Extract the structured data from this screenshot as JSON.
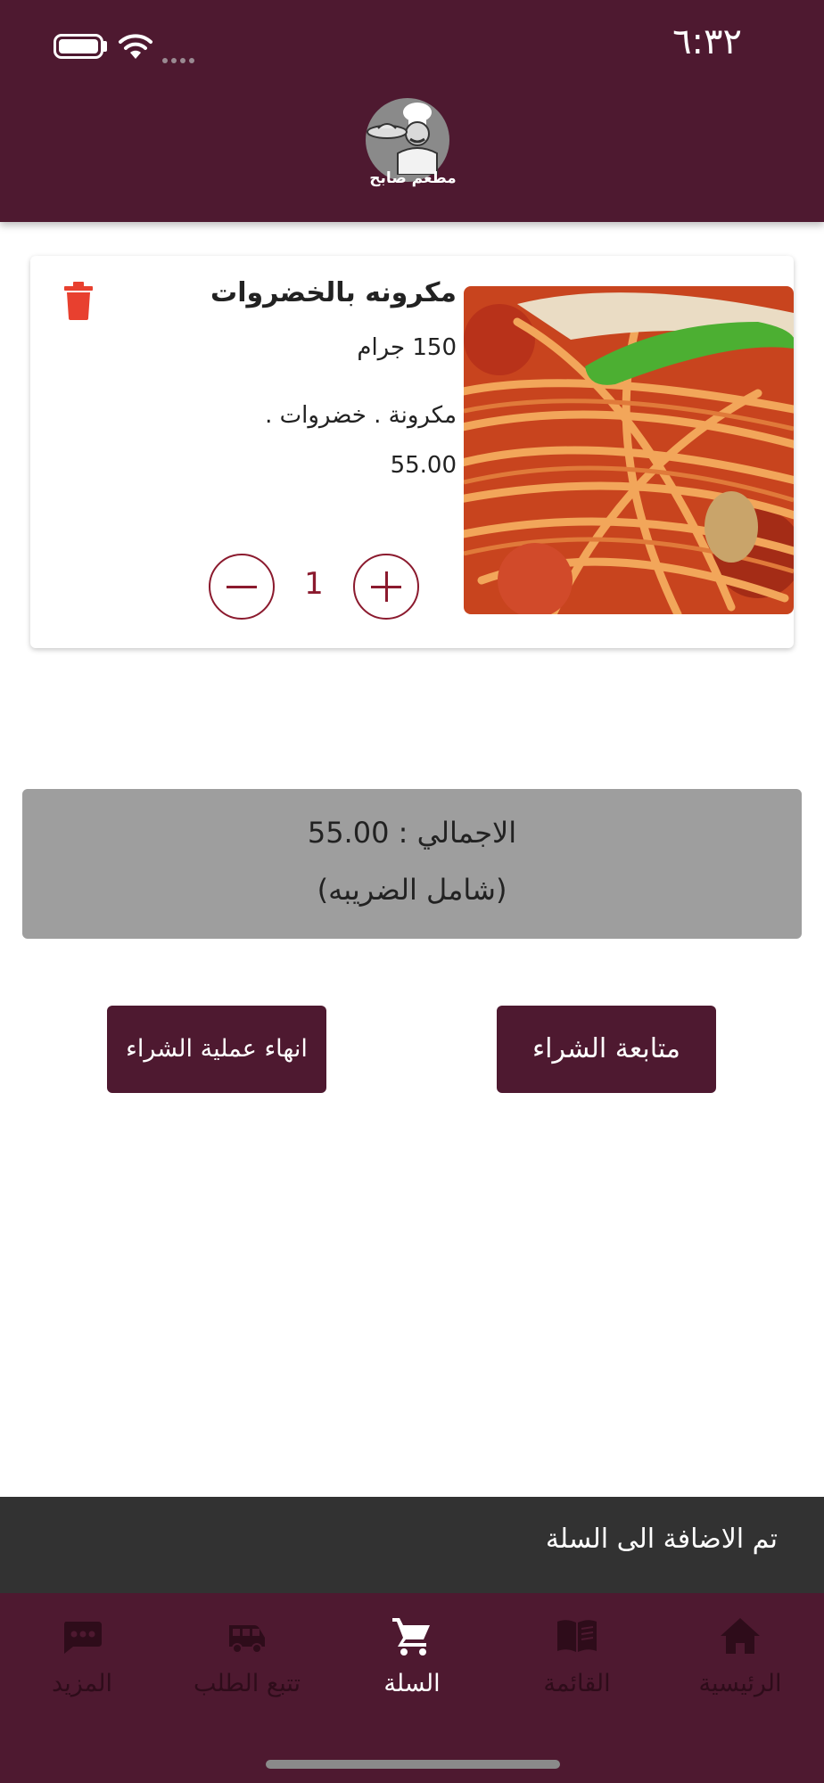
{
  "status_bar": {
    "time": "٦:٣٢"
  },
  "header": {
    "logo_text": "مطعم صابح"
  },
  "cart_item": {
    "name": "مكرونه بالخضروات",
    "weight": "150 جرام",
    "description": "مكرونة . خضروات .",
    "price": "55.00",
    "quantity": "1",
    "image_icon": "pasta-photo"
  },
  "summary": {
    "total_text": "الاجمالي : 55.00",
    "tax_note": "(شامل الضريبه)"
  },
  "actions": {
    "finish_label": "انهاء عملية الشراء",
    "continue_label": "متابعة الشراء"
  },
  "toast": {
    "message": "تم الاضافة الى السلة"
  },
  "bottom_nav": {
    "items": [
      {
        "label": "المزيد",
        "icon": "more-chat-icon"
      },
      {
        "label": "تتبع الطلب",
        "icon": "delivery-van-icon"
      },
      {
        "label": "السلة",
        "icon": "cart-icon",
        "active": true
      },
      {
        "label": "القائمة",
        "icon": "menu-book-icon"
      },
      {
        "label": "الرئيسية",
        "icon": "home-icon"
      }
    ]
  },
  "colors": {
    "brand": "#4e1930",
    "accent": "#8b1a2e",
    "delete": "#e8402f",
    "toast_bg": "#323232"
  }
}
